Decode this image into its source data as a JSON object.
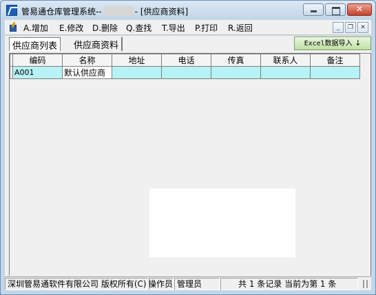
{
  "window": {
    "title_prefix": "管易通仓库管理系统--",
    "title_suffix": "- [供应商资料]"
  },
  "menu": [
    {
      "label": "A.增加"
    },
    {
      "label": "E.修改"
    },
    {
      "label": "D.删除"
    },
    {
      "label": "Q.查找"
    },
    {
      "label": "T.导出"
    },
    {
      "label": "P.打印"
    },
    {
      "label": "R.返回"
    }
  ],
  "tabs": [
    {
      "label": "供应商列表",
      "active": true
    },
    {
      "label": "供应商资料",
      "active": false
    }
  ],
  "excel_button": {
    "label": "Excel数据导入",
    "icon": "arrow-down"
  },
  "table": {
    "columns": [
      "编码",
      "名称",
      "地址",
      "电话",
      "传真",
      "联系人",
      "备注"
    ],
    "rows": [
      [
        "A001",
        "默认供应商",
        "",
        "",
        "",
        "",
        ""
      ]
    ]
  },
  "status": {
    "company": "深圳管易通软件有限公司 版权所有(C)",
    "operator_label": "操作员:",
    "operator_value": "管理员",
    "record_info": "共 1 条记录 当前为第 1 条"
  },
  "colors": {
    "row_fill": "#b7f2f5",
    "excel_button": "#c8e6ae",
    "window_frame": "#c3d6e8"
  }
}
